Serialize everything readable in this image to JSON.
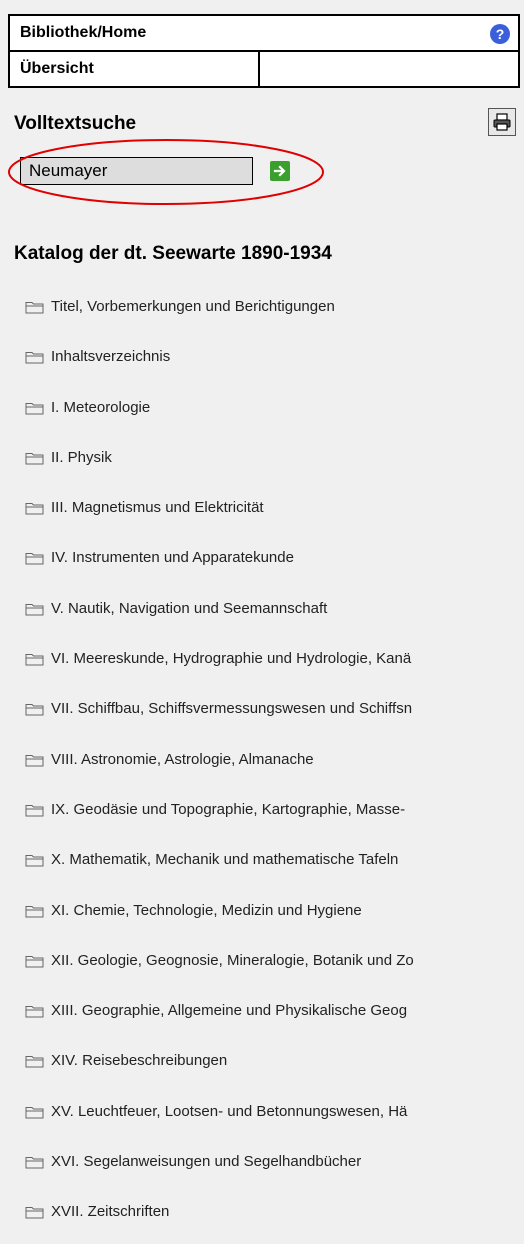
{
  "nav": {
    "home_label": "Bibliothek/Home",
    "overview_label": "Übersicht",
    "empty_cell": ""
  },
  "search": {
    "title": "Volltextsuche",
    "value": "Neumayer"
  },
  "catalog": {
    "title": "Katalog der dt. Seewarte 1890-1934",
    "items": [
      {
        "label": "Titel, Vorbemerkungen und Berichtigungen"
      },
      {
        "label": "Inhaltsverzeichnis"
      },
      {
        "label": "I. Meteorologie"
      },
      {
        "label": "II. Physik"
      },
      {
        "label": "III. Magnetismus und Elektricität"
      },
      {
        "label": "IV. Instrumenten und Apparatekunde"
      },
      {
        "label": "V. Nautik, Navigation und Seemannschaft"
      },
      {
        "label": "VI. Meereskunde, Hydrographie und Hydrologie, Kanä"
      },
      {
        "label": "VII. Schiffbau, Schiffsvermessungswesen und Schiffsn"
      },
      {
        "label": "VIII. Astronomie, Astrologie, Almanache"
      },
      {
        "label": "IX. Geodäsie und Topographie, Kartographie, Masse-"
      },
      {
        "label": "X. Mathematik, Mechanik und mathematische Tafeln"
      },
      {
        "label": "XI. Chemie, Technologie, Medizin und Hygiene"
      },
      {
        "label": "XII. Geologie, Geognosie, Mineralogie, Botanik und Zo"
      },
      {
        "label": "XIII. Geographie, Allgemeine und Physikalische Geog"
      },
      {
        "label": "XIV. Reisebeschreibungen"
      },
      {
        "label": "XV. Leuchtfeuer, Lootsen- und Betonnungswesen, Hä"
      },
      {
        "label": "XVI. Segelanweisungen und Segelhandbücher"
      },
      {
        "label": "XVII. Zeitschriften"
      }
    ]
  },
  "icons": {
    "help": "help-icon",
    "print": "printer-icon",
    "go": "arrow-right-icon",
    "folder": "folder-icon"
  },
  "colors": {
    "background": "#f0f0f0",
    "help_icon": "#3a5fd8",
    "go_icon": "#3aa02d",
    "highlight": "#e00000"
  }
}
